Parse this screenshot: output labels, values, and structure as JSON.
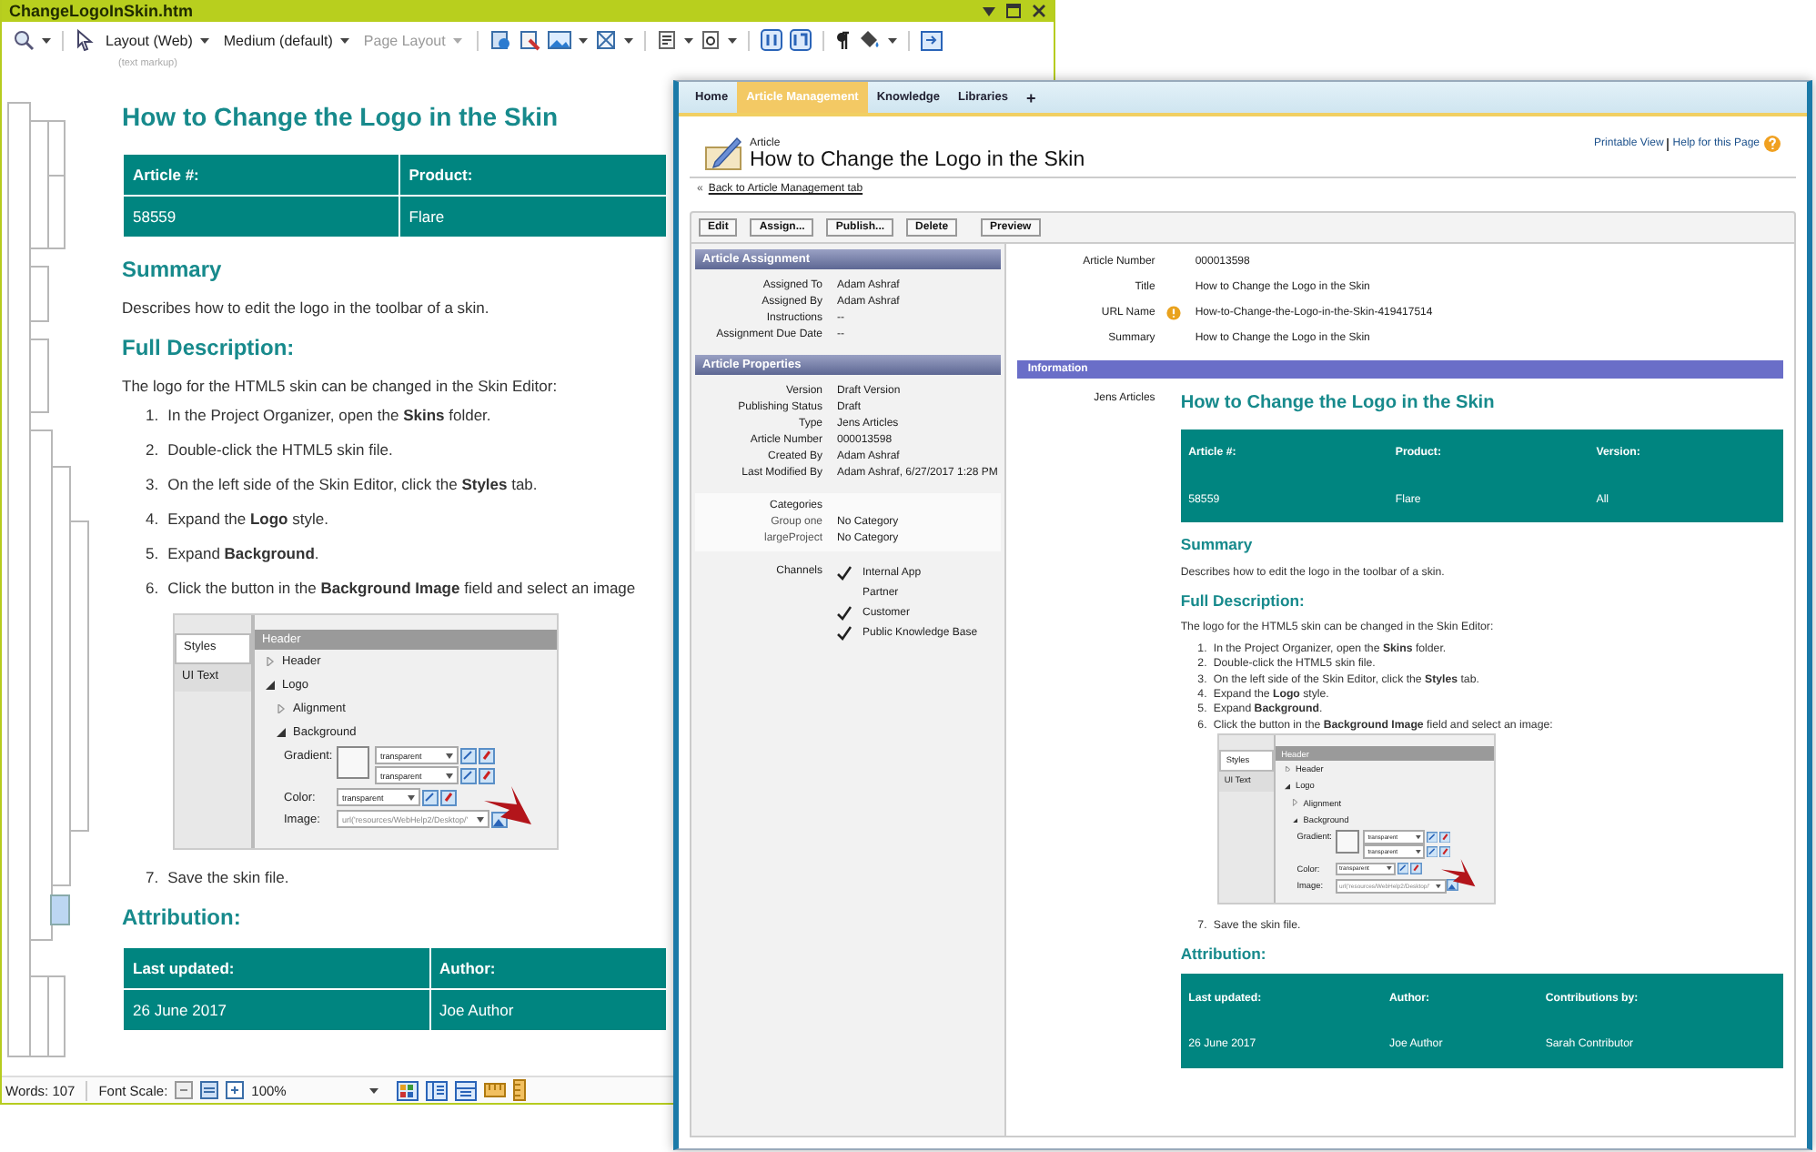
{
  "editor": {
    "title": "ChangeLogoInSkin.htm",
    "toolbar": [
      {
        "label": "Layout (Web)",
        "disabled": false
      },
      {
        "label": "Medium (default)",
        "disabled": false
      },
      {
        "label": "Page Layout",
        "disabled": true
      }
    ],
    "markup_hint": "(text markup)",
    "document": {
      "title": "How to Change the Logo in the Skin",
      "info_table": {
        "columns": [
          "Article #:",
          "Product:"
        ],
        "rows": [
          [
            "58559",
            "Flare"
          ]
        ]
      },
      "blocks": [
        {
          "kind": "heading",
          "text": "Summary"
        },
        {
          "kind": "paragraph",
          "text": "Describes how to edit the logo in the toolbar of a skin."
        },
        {
          "kind": "heading",
          "text": "Full Description:"
        },
        {
          "kind": "paragraph",
          "text": "The logo for the HTML5 skin can be changed in the Skin Editor:"
        },
        {
          "kind": "step",
          "number": "1.",
          "text": "In the Project Organizer, open the **Skins** folder."
        },
        {
          "kind": "step",
          "number": "2.",
          "text": "Double-click the HTML5 skin file."
        },
        {
          "kind": "step",
          "number": "3.",
          "text": "On the left side of the Skin Editor, click the **Styles** tab."
        },
        {
          "kind": "step",
          "number": "4.",
          "text": "Expand the **Logo** style."
        },
        {
          "kind": "step",
          "number": "5.",
          "text": "Expand **Background**."
        },
        {
          "kind": "step",
          "number": "6.",
          "text": "Click the button in the **Background Image** field and select an image"
        },
        {
          "kind": "screenshot",
          "tabs": [
            {
              "label": "Styles",
              "selected": true
            },
            {
              "label": "UI Text",
              "selected": false
            }
          ],
          "header": "Header",
          "tree": [
            {
              "label": "Header",
              "expanded": false
            },
            {
              "label": "Logo",
              "expanded": true,
              "children": [
                {
                  "label": "Alignment",
                  "expanded": false
                },
                {
                  "label": "Background",
                  "expanded": true
                }
              ]
            }
          ],
          "fields": [
            {
              "kind": "gradient",
              "label": "Gradient:",
              "values": [
                "transparent",
                "transparent"
              ]
            },
            {
              "kind": "color",
              "label": "Color:",
              "values": [
                "transparent"
              ]
            },
            {
              "kind": "image",
              "label": "Image:",
              "values": [
                "url('resources/WebHelp2/Desktop/'"
              ]
            }
          ]
        },
        {
          "kind": "step",
          "number": "7.",
          "text": "Save the skin file."
        },
        {
          "kind": "heading",
          "text": "Attribution:"
        },
        {
          "kind": "table",
          "columns": [
            "Last updated:",
            "Author:"
          ],
          "rows": [
            [
              "26 June 2017",
              "Joe Author"
            ]
          ]
        }
      ]
    },
    "status": {
      "words": "Words: 107",
      "font_scale": "Font Scale:",
      "zoom": "100%"
    }
  },
  "browser": {
    "tabs": [
      {
        "label": "Home",
        "selected": false
      },
      {
        "label": "Article Management",
        "selected": true
      },
      {
        "label": "Knowledge",
        "selected": false
      },
      {
        "label": "Libraries",
        "selected": false
      }
    ],
    "tab_add": "+",
    "object_type": "Article",
    "title": "How to Change the Logo in the Skin",
    "links": [
      "Printable View",
      "Help for this Page"
    ],
    "back_marker": "«",
    "back_link": "Back to Article Management tab",
    "buttons": [
      "Edit",
      "Assign...",
      "Publish...",
      "Delete",
      "Preview"
    ],
    "assignment": {
      "heading": "Article Assignment",
      "fields": [
        {
          "label": "Assigned To",
          "value": "Adam Ashraf"
        },
        {
          "label": "Assigned By",
          "value": "Adam Ashraf"
        },
        {
          "label": "Instructions",
          "value": "--"
        },
        {
          "label": "Assignment Due Date",
          "value": "--"
        }
      ]
    },
    "properties": {
      "heading": "Article Properties",
      "fields": [
        {
          "label": "Version",
          "value": "Draft Version"
        },
        {
          "label": "Publishing Status",
          "value": "Draft"
        },
        {
          "label": "Type",
          "value": "Jens Articles"
        },
        {
          "label": "Article Number",
          "value": "000013598"
        },
        {
          "label": "Created By",
          "value": "Adam Ashraf"
        },
        {
          "label": "Last Modified By",
          "value": "Adam Ashraf, 6/27/2017 1:28 PM"
        }
      ]
    },
    "categories": {
      "label": "Categories",
      "groups": [
        {
          "label": "Group one",
          "value": "No Category"
        },
        {
          "label": "largeProject",
          "value": "No Category"
        }
      ]
    },
    "channels": {
      "label": "Channels",
      "items": [
        {
          "label": "Internal App",
          "checked": true
        },
        {
          "label": "Partner",
          "checked": false
        },
        {
          "label": "Customer",
          "checked": true
        },
        {
          "label": "Public Knowledge Base",
          "checked": true
        }
      ]
    },
    "summary_fields": [
      {
        "label": "Article Number",
        "value": "000013598",
        "warning": false
      },
      {
        "label": "Title",
        "value": "How to Change the Logo in the Skin",
        "warning": false
      },
      {
        "label": "URL Name",
        "value": "How-to-Change-the-Logo-in-the-Skin-419417514",
        "warning": true
      },
      {
        "label": "Summary",
        "value": "How to Change the Logo in the Skin",
        "warning": false
      }
    ],
    "information": "Information",
    "article_type": "Jens Articles",
    "article": {
      "title": "How to Change the Logo in the Skin",
      "info_table": {
        "columns": [
          "Article #:",
          "Product:",
          "Version:"
        ],
        "rows": [
          [
            "58559",
            "Flare",
            "All"
          ]
        ]
      },
      "blocks": [
        {
          "kind": "heading",
          "text": "Summary"
        },
        {
          "kind": "paragraph",
          "text": "Describes how to edit the logo in the toolbar of a skin."
        },
        {
          "kind": "heading",
          "text": "Full Description:"
        },
        {
          "kind": "paragraph",
          "text": "The logo for the HTML5 skin can be changed in the Skin Editor:"
        },
        {
          "kind": "step",
          "number": "1.",
          "text": "In the Project Organizer, open the **Skins** folder."
        },
        {
          "kind": "step",
          "number": "2.",
          "text": "Double-click the HTML5 skin file."
        },
        {
          "kind": "step",
          "number": "3.",
          "text": "On the left side of the Skin Editor, click the **Styles** tab."
        },
        {
          "kind": "step",
          "number": "4.",
          "text": "Expand the **Logo** style."
        },
        {
          "kind": "step",
          "number": "5.",
          "text": "Expand **Background**."
        },
        {
          "kind": "step",
          "number": "6.",
          "text": "Click the button in the **Background Image** field and select an image:"
        },
        {
          "kind": "screenshot",
          "tabs": [
            {
              "label": "Styles",
              "selected": true
            },
            {
              "label": "UI Text",
              "selected": false
            }
          ],
          "header": "Header",
          "tree": [
            {
              "label": "Header",
              "expanded": false
            },
            {
              "label": "Logo",
              "expanded": true,
              "children": [
                {
                  "label": "Alignment",
                  "expanded": false
                },
                {
                  "label": "Background",
                  "expanded": true
                }
              ]
            }
          ],
          "fields": [
            {
              "kind": "gradient",
              "label": "Gradient:",
              "values": [
                "transparent",
                "transparent"
              ]
            },
            {
              "kind": "color",
              "label": "Color:",
              "values": [
                "transparent"
              ]
            },
            {
              "kind": "image",
              "label": "Image:",
              "values": [
                "url('resources/WebHelp2/Desktop/'"
              ]
            }
          ]
        },
        {
          "kind": "step",
          "number": "7.",
          "text": "Save the skin file."
        },
        {
          "kind": "heading",
          "text": "Attribution:"
        },
        {
          "kind": "table",
          "columns": [
            "Last updated:",
            "Author:",
            "Contributions by:"
          ],
          "rows": [
            [
              "26 June 2017",
              "Joe Author",
              "Sarah Contributor"
            ]
          ]
        }
      ]
    }
  }
}
